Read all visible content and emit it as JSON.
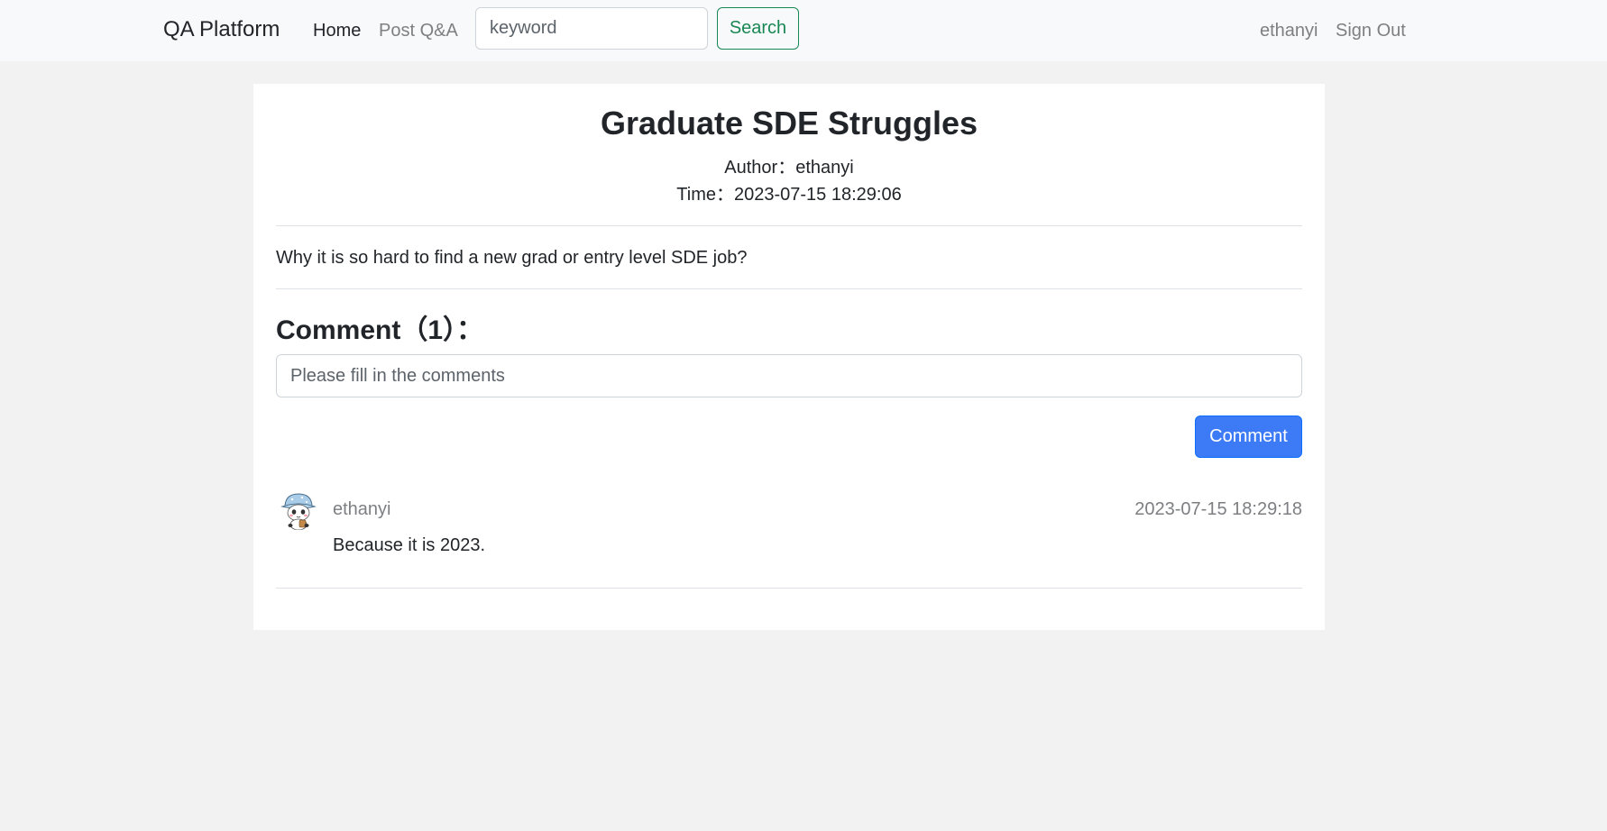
{
  "navbar": {
    "brand": "QA Platform",
    "links": {
      "home": "Home",
      "post": "Post Q&A"
    },
    "search": {
      "placeholder": "keyword",
      "button_label": "Search"
    },
    "user": "ethanyi",
    "sign_out": "Sign Out"
  },
  "question": {
    "title": "Graduate SDE Struggles",
    "author_line": "Author：ethanyi",
    "time_line": "Time：2023-07-15 18:29:06",
    "body": "Why it is so hard to find a new grad or entry level SDE job?"
  },
  "comments": {
    "heading": "Comment（1）：",
    "input_placeholder": "Please fill in the comments",
    "submit_label": "Comment",
    "items": [
      {
        "avatar_icon": "panda-avatar-icon",
        "username": "ethanyi",
        "time": "2023-07-15 18:29:18",
        "text": "Because it is 2023."
      }
    ]
  },
  "colors": {
    "page_bg": "#f2f2f2",
    "navbar_bg": "#f8f9fa",
    "card_bg": "#ffffff",
    "success_outline": "#198754",
    "primary": "#3c7bf5",
    "muted_text": "#7d7f82"
  }
}
